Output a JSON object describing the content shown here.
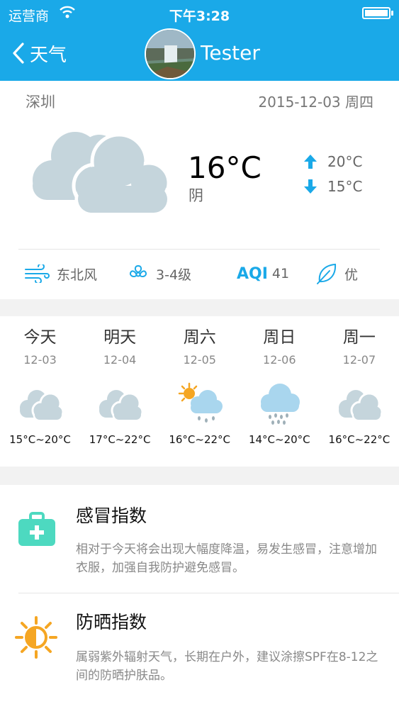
{
  "status_bar": {
    "carrier": "运营商",
    "time": "下午3:28"
  },
  "nav": {
    "back_label": "天气",
    "title": "Tester"
  },
  "today": {
    "city": "深圳",
    "date": "2015-12-03 周四",
    "temp": "16°C",
    "condition": "阴",
    "high": "20°C",
    "low": "15°C",
    "icon": "cloudy-icon"
  },
  "details": {
    "wind_dir": "东北风",
    "wind_level": "3-4级",
    "aqi_label": "AQI",
    "aqi_value": "41",
    "quality": "优"
  },
  "forecast": [
    {
      "day": "今天",
      "date": "12-03",
      "range": "15°C~20°C",
      "icon": "cloudy-icon"
    },
    {
      "day": "明天",
      "date": "12-04",
      "range": "17°C~22°C",
      "icon": "cloudy-icon"
    },
    {
      "day": "周六",
      "date": "12-05",
      "range": "16°C~22°C",
      "icon": "sun-rain-icon"
    },
    {
      "day": "周日",
      "date": "12-06",
      "range": "14°C~20°C",
      "icon": "rain-icon"
    },
    {
      "day": "周一",
      "date": "12-07",
      "range": "16°C~22°C",
      "icon": "cloudy-icon"
    }
  ],
  "indices": [
    {
      "title": "感冒指数",
      "desc": "相对于今天将会出现大幅度降温，易发生感冒，注意增加衣服，加强自我防护避免感冒。",
      "icon": "medical-kit-icon"
    },
    {
      "title": "防晒指数",
      "desc": "属弱紫外辐射天气，长期在户外，建议涂擦SPF在8-12之间的防晒护肤品。",
      "icon": "sun-icon"
    }
  ],
  "colors": {
    "accent": "#1aa9e8",
    "cloud": "#c5d5dc",
    "sun": "#f5a623",
    "kit": "#4dd9c0"
  }
}
